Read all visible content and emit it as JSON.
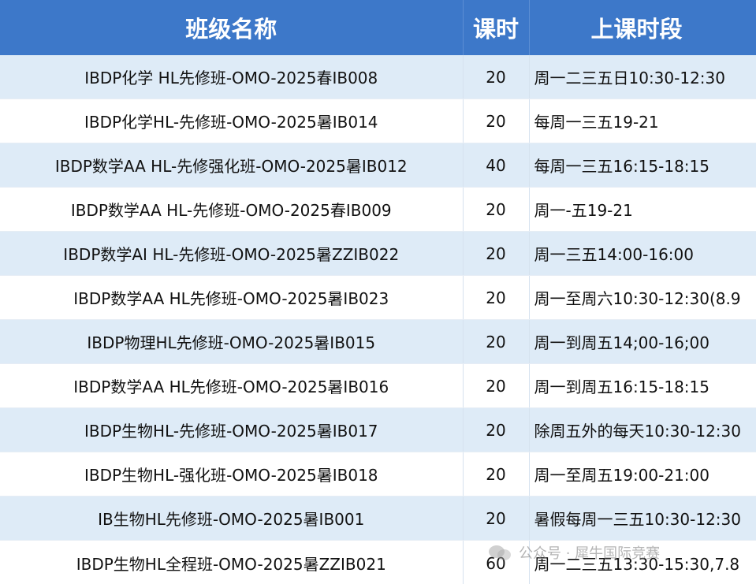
{
  "header": {
    "class_name": "班级名称",
    "hours": "课时",
    "schedule": "上课时段"
  },
  "rows": [
    {
      "name": "IBDP化学 HL先修班-OMO-2025春IB008",
      "hours": "20",
      "schedule": "周一二三五日10:30-12:30"
    },
    {
      "name": "IBDP化学HL-先修班-OMO-2025暑IB014",
      "hours": "20",
      "schedule": "每周一三五19-21"
    },
    {
      "name": "IBDP数学AA HL-先修强化班-OMO-2025暑IB012",
      "hours": "40",
      "schedule": "每周一三五16:15-18:15"
    },
    {
      "name": "IBDP数学AA HL-先修班-OMO-2025春IB009",
      "hours": "20",
      "schedule": "周一-五19-21"
    },
    {
      "name": "IBDP数学AI HL-先修班-OMO-2025暑ZZIB022",
      "hours": "20",
      "schedule": "周一三五14:00-16:00"
    },
    {
      "name": "IBDP数学AA HL先修班-OMO-2025暑IB023",
      "hours": "20",
      "schedule": "周一至周六10:30-12:30(8.9"
    },
    {
      "name": "IBDP物理HL先修班-OMO-2025暑IB015",
      "hours": "20",
      "schedule": "周一到周五14;00-16;00"
    },
    {
      "name": "IBDP数学AA HL先修班-OMO-2025暑IB016",
      "hours": "20",
      "schedule": "周一到周五16:15-18:15"
    },
    {
      "name": "IBDP生物HL-先修班-OMO-2025暑IB017",
      "hours": "20",
      "schedule": "除周五外的每天10:30-12:30"
    },
    {
      "name": "IBDP生物HL-强化班-OMO-2025暑IB018",
      "hours": "20",
      "schedule": "周一至周五19:00-21:00"
    },
    {
      "name": "IB生物HL先修班-OMO-2025暑IB001",
      "hours": "20",
      "schedule": "暑假每周一三五10:30-12:30"
    },
    {
      "name": "IBDP生物HL全程班-OMO-2025暑ZZIB021",
      "hours": "60",
      "schedule": "周一二三五13:30-15:30,7.8"
    }
  ],
  "watermark": {
    "icon": "wechat-icon",
    "text": "公众号 · 犀牛国际竞赛"
  }
}
